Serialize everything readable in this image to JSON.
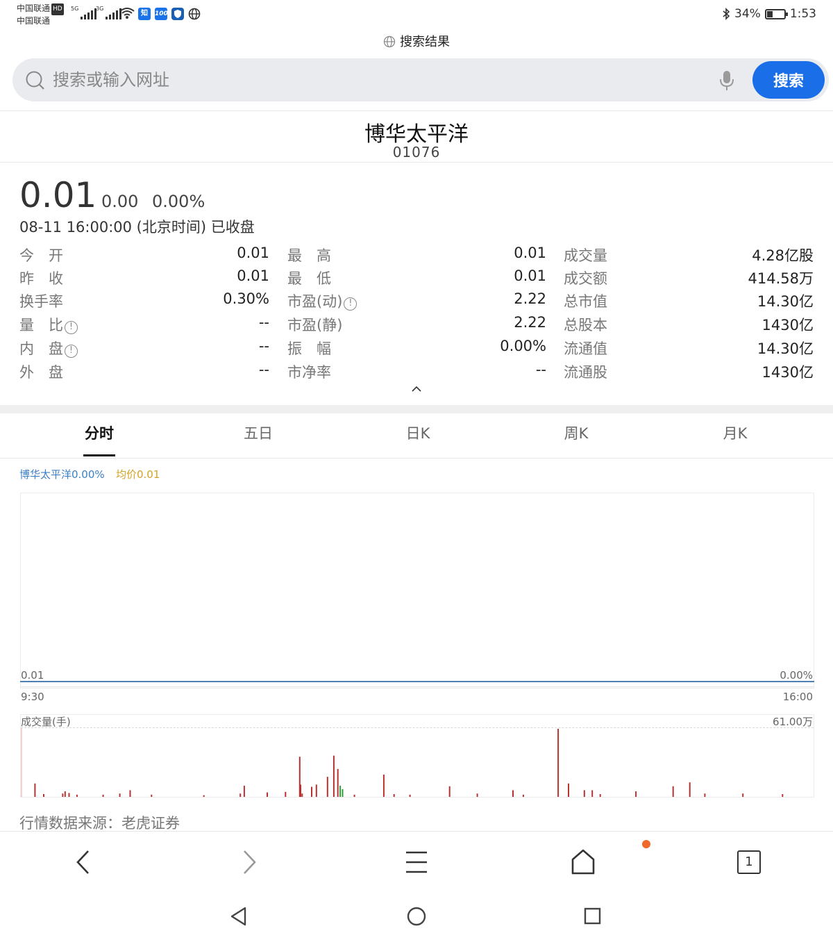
{
  "status_bar": {
    "carrier1": "中国联通",
    "carrier2": "中国联通",
    "hd": "HD",
    "net1": "5G",
    "net2": "3G",
    "app_icon_1": "知",
    "app_icon_2": "100",
    "battery": "34%",
    "battery_level": 0.34,
    "time": "1:53"
  },
  "page_label": "搜索结果",
  "search": {
    "placeholder": "搜索或输入网址",
    "button": "搜索"
  },
  "stock": {
    "name": "博华太平洋",
    "code": "01076",
    "price": "0.01",
    "change": "0.00",
    "change_pct": "0.00%",
    "time": "08-11 16:00:00 (北京时间) 已收盘"
  },
  "stats": [
    {
      "l1": "今　开",
      "v1": "0.01",
      "l2": "最　高",
      "v2": "0.01",
      "l3": "成交量",
      "v3": "4.28亿股"
    },
    {
      "l1": "昨　收",
      "v1": "0.01",
      "l2": "最　低",
      "v2": "0.01",
      "l3": "成交额",
      "v3": "414.58万"
    },
    {
      "l1": "换手率",
      "v1": "0.30%",
      "l2": "市盈(动)",
      "v2": "2.22",
      "l3": "总市值",
      "v3": "14.30亿"
    },
    {
      "l1": "量　比",
      "v1": "--",
      "l2": "市盈(静)",
      "v2": "2.22",
      "l3": "总股本",
      "v3": "1430亿"
    },
    {
      "l1": "内　盘",
      "v1": "--",
      "l2": "振　幅",
      "v2": "0.00%",
      "l3": "流通值",
      "v3": "14.30亿"
    },
    {
      "l1": "外　盘",
      "v1": "--",
      "l2": "市净率",
      "v2": "--",
      "l3": "流通股",
      "v3": "1430亿"
    }
  ],
  "info_mark": "!",
  "tabs": [
    "分时",
    "五日",
    "日K",
    "周K",
    "月K"
  ],
  "legend": {
    "price": "博华太平洋0.00%",
    "avg": "均价0.01"
  },
  "chart": {
    "price_label": "0.01",
    "pct_label": "0.00%",
    "time_start": "9:30",
    "time_end": "16:00",
    "volume_title": "成交量(手)",
    "volume_max": "61.00万"
  },
  "chart_data": {
    "type": "bar",
    "title": "成交量(手)",
    "ylim": [
      0,
      610000
    ],
    "x_range": [
      "9:30",
      "16:00"
    ],
    "bar_color_up": "#b83232",
    "bar_color_down": "#2e9e3e",
    "bars": [
      {
        "x": 0.017,
        "v": 120000,
        "c": "up"
      },
      {
        "x": 0.028,
        "v": 25000,
        "c": "up"
      },
      {
        "x": 0.052,
        "v": 30000,
        "c": "up"
      },
      {
        "x": 0.055,
        "v": 50000,
        "c": "up"
      },
      {
        "x": 0.06,
        "v": 35000,
        "c": "up"
      },
      {
        "x": 0.07,
        "v": 20000,
        "c": "up"
      },
      {
        "x": 0.103,
        "v": 20000,
        "c": "up"
      },
      {
        "x": 0.124,
        "v": 30000,
        "c": "up"
      },
      {
        "x": 0.137,
        "v": 60000,
        "c": "up"
      },
      {
        "x": 0.164,
        "v": 20000,
        "c": "up"
      },
      {
        "x": 0.23,
        "v": 15000,
        "c": "up"
      },
      {
        "x": 0.276,
        "v": 30000,
        "c": "up"
      },
      {
        "x": 0.281,
        "v": 100000,
        "c": "up"
      },
      {
        "x": 0.31,
        "v": 40000,
        "c": "up"
      },
      {
        "x": 0.333,
        "v": 45000,
        "c": "up"
      },
      {
        "x": 0.354,
        "v": 30000,
        "c": "up"
      },
      {
        "x": 0.366,
        "v": 90000,
        "c": "up"
      },
      {
        "x": 0.372,
        "v": 110000,
        "c": "up"
      },
      {
        "x": 0.352,
        "v": 110000,
        "c": "up"
      },
      {
        "x": 0.351,
        "v": 360000,
        "c": "up"
      },
      {
        "x": 0.386,
        "v": 180000,
        "c": "up"
      },
      {
        "x": 0.394,
        "v": 370000,
        "c": "up"
      },
      {
        "x": 0.399,
        "v": 250000,
        "c": "up"
      },
      {
        "x": 0.402,
        "v": 100000,
        "c": "down"
      },
      {
        "x": 0.405,
        "v": 70000,
        "c": "down"
      },
      {
        "x": 0.42,
        "v": 20000,
        "c": "up"
      },
      {
        "x": 0.457,
        "v": 200000,
        "c": "up"
      },
      {
        "x": 0.47,
        "v": 25000,
        "c": "up"
      },
      {
        "x": 0.49,
        "v": 20000,
        "c": "up"
      },
      {
        "x": 0.54,
        "v": 95000,
        "c": "up"
      },
      {
        "x": 0.575,
        "v": 30000,
        "c": "up"
      },
      {
        "x": 0.62,
        "v": 60000,
        "c": "up"
      },
      {
        "x": 0.633,
        "v": 20000,
        "c": "up"
      },
      {
        "x": 0.677,
        "v": 610000,
        "c": "up"
      },
      {
        "x": 0.69,
        "v": 120000,
        "c": "up"
      },
      {
        "x": 0.71,
        "v": 60000,
        "c": "up"
      },
      {
        "x": 0.72,
        "v": 60000,
        "c": "up"
      },
      {
        "x": 0.73,
        "v": 25000,
        "c": "up"
      },
      {
        "x": 0.775,
        "v": 50000,
        "c": "up"
      },
      {
        "x": 0.822,
        "v": 95000,
        "c": "up"
      },
      {
        "x": 0.843,
        "v": 130000,
        "c": "up"
      },
      {
        "x": 0.862,
        "v": 30000,
        "c": "up"
      },
      {
        "x": 0.91,
        "v": 30000,
        "c": "up"
      },
      {
        "x": 0.96,
        "v": 25000,
        "c": "up"
      }
    ]
  },
  "page_number": "1",
  "source": "行情数据来源：老虎证券"
}
